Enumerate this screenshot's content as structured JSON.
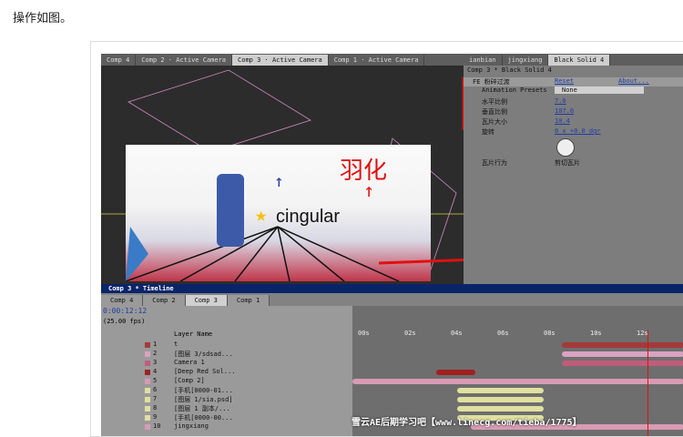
{
  "page": {
    "caption": "操作如图。"
  },
  "ae": {
    "comp_tabs": [
      "Comp 4",
      "Comp 2 · Active Camera",
      "Comp 3 · Active Camera",
      "Comp 1 · Active Camera"
    ],
    "effect_tabs": [
      "ianbian",
      "jingxiang",
      "Black Solid 4"
    ],
    "effect_path": "Comp 3 * Black Solid 4",
    "effect": {
      "name": "FE 粉碎过渡",
      "reset": "Reset",
      "about": "About...",
      "presets_label": "Animation Presets",
      "presets_value": "None",
      "params": [
        {
          "label": "水平比例",
          "value": "7.0"
        },
        {
          "label": "垂直比例",
          "value": "107.0"
        },
        {
          "label": "瓦片大小",
          "value": "10.4"
        },
        {
          "label": "旋转",
          "value": "0 x +0.0 dgr"
        },
        {
          "label": "瓦片行为",
          "value": "剪切瓦片"
        }
      ]
    },
    "annotation": "羽化",
    "logo_text": "cingular",
    "timeline": {
      "title": "Comp 3 * Timeline",
      "tabs": [
        "Comp 4",
        "Comp 2",
        "Comp 3",
        "Comp 1"
      ],
      "timecode": "0:00:12:12",
      "fps": "(25.00 fps)",
      "col_header": "Layer Name",
      "ticks": [
        "00s",
        "02s",
        "04s",
        "06s",
        "08s",
        "10s",
        "12s"
      ],
      "layers": [
        {
          "num": "1",
          "name": "t",
          "color": "#a43a3a"
        },
        {
          "num": "2",
          "name": "[图层 3/sdsad...",
          "color": "#d9a3c0"
        },
        {
          "num": "3",
          "name": "Camera 1",
          "color": "#c05c7a"
        },
        {
          "num": "4",
          "name": "[Deep Red Sol...",
          "color": "#a02020"
        },
        {
          "num": "5",
          "name": "[Comp 2]",
          "color": "#d89bb3"
        },
        {
          "num": "6",
          "name": "[手机[0000-01...",
          "color": "#e0e0a0"
        },
        {
          "num": "7",
          "name": "[图层 1/sia.psd]",
          "color": "#e0e0a0"
        },
        {
          "num": "8",
          "name": "[图层 1 副本/...",
          "color": "#e0e0a0"
        },
        {
          "num": "9",
          "name": "[手机[0000-00...",
          "color": "#e0e0a0"
        },
        {
          "num": "10",
          "name": "jingxiang",
          "color": "#d89bb3"
        }
      ]
    },
    "watermark": "雪云AE后期学习吧【www.linecg.com/tieba/1775】"
  }
}
